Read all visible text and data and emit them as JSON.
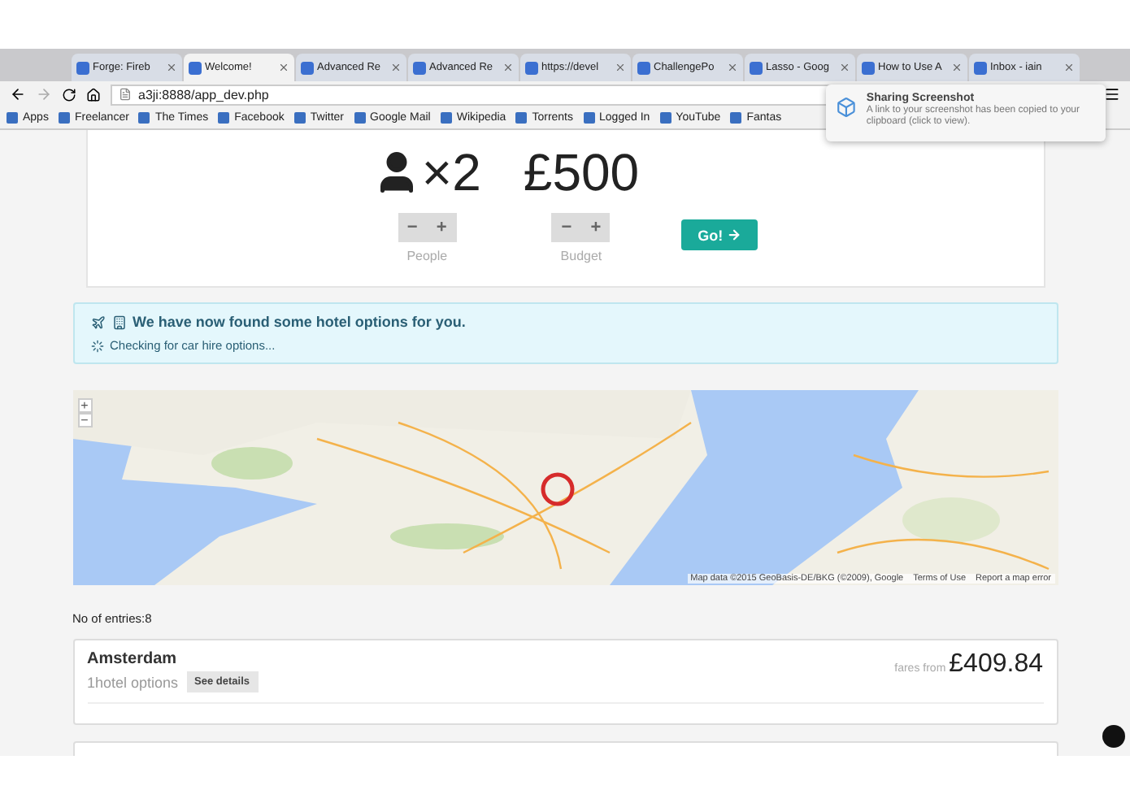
{
  "browser": {
    "tabs": [
      {
        "label": "Forge: Fireb",
        "selected": false
      },
      {
        "label": "Welcome!",
        "selected": true
      },
      {
        "label": "Advanced Re",
        "selected": false
      },
      {
        "label": "Advanced Re",
        "selected": false
      },
      {
        "label": "https://devel",
        "selected": false
      },
      {
        "label": "ChallengePo",
        "selected": false
      },
      {
        "label": "Lasso - Goog",
        "selected": false
      },
      {
        "label": "How to Use A",
        "selected": false
      },
      {
        "label": "Inbox - iain",
        "selected": false
      }
    ],
    "address": "a3ji:8888/app_dev.php",
    "bookmarks": [
      "Apps",
      "Freelancer",
      "The Times",
      "Facebook",
      "Twitter",
      "Google Mail",
      "Wikipedia",
      "Torrents",
      "Logged In",
      "YouTube",
      "Fantas"
    ]
  },
  "notification": {
    "title": "Sharing Screenshot",
    "message": "A link to your screenshot has been copied to your clipboard (click to view)."
  },
  "search": {
    "people": "×2",
    "budget": "£500",
    "people_label": "People",
    "budget_label": "Budget",
    "minus": "−",
    "plus": "+",
    "go": "Go!"
  },
  "alert": {
    "title": "We have now found some hotel options for you.",
    "status": "Checking for car hire options..."
  },
  "map": {
    "zoom_in": "+",
    "zoom_out": "−",
    "attribution": "Map data ©2015 GeoBasis-DE/BKG (©2009), Google",
    "terms": "Terms of Use",
    "report": "Report a map error"
  },
  "entries_count": "No of entries:8",
  "results": [
    {
      "city": "Amsterdam",
      "options": "1hotel options",
      "details": "See details",
      "fares_label": "fares from",
      "price": "£409.84"
    }
  ]
}
